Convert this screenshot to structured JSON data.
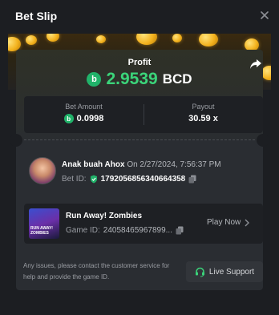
{
  "header": {
    "title": "Bet Slip"
  },
  "profit": {
    "label": "Profit",
    "value": "2.9539",
    "currency": "BCD",
    "currency_icon": "bcd-coin-icon"
  },
  "stats": {
    "bet_amount_label": "Bet Amount",
    "bet_amount_value": "0.0998",
    "payout_label": "Payout",
    "payout_value": "30.59 x"
  },
  "user": {
    "name": "Anak buah Ahox",
    "date_text": "On 2/27/2024, 7:56:37 PM",
    "bet_id_label": "Bet ID:",
    "bet_id_value": "1792056856340664358"
  },
  "game": {
    "title": "Run Away! Zombies",
    "thumb_text": "RUN AWAY! ZOMBIES",
    "game_id_label": "Game ID:",
    "game_id_value": "24058465967899...",
    "play_label": "Play Now"
  },
  "support": {
    "text": "Any issues, please contact the customer service for help and provide the game ID.",
    "button_label": "Live Support"
  },
  "colors": {
    "profit_green": "#3bd47a",
    "bcd_green": "#21b36a",
    "background": "#1c1e22",
    "card": "#2a2d32"
  }
}
